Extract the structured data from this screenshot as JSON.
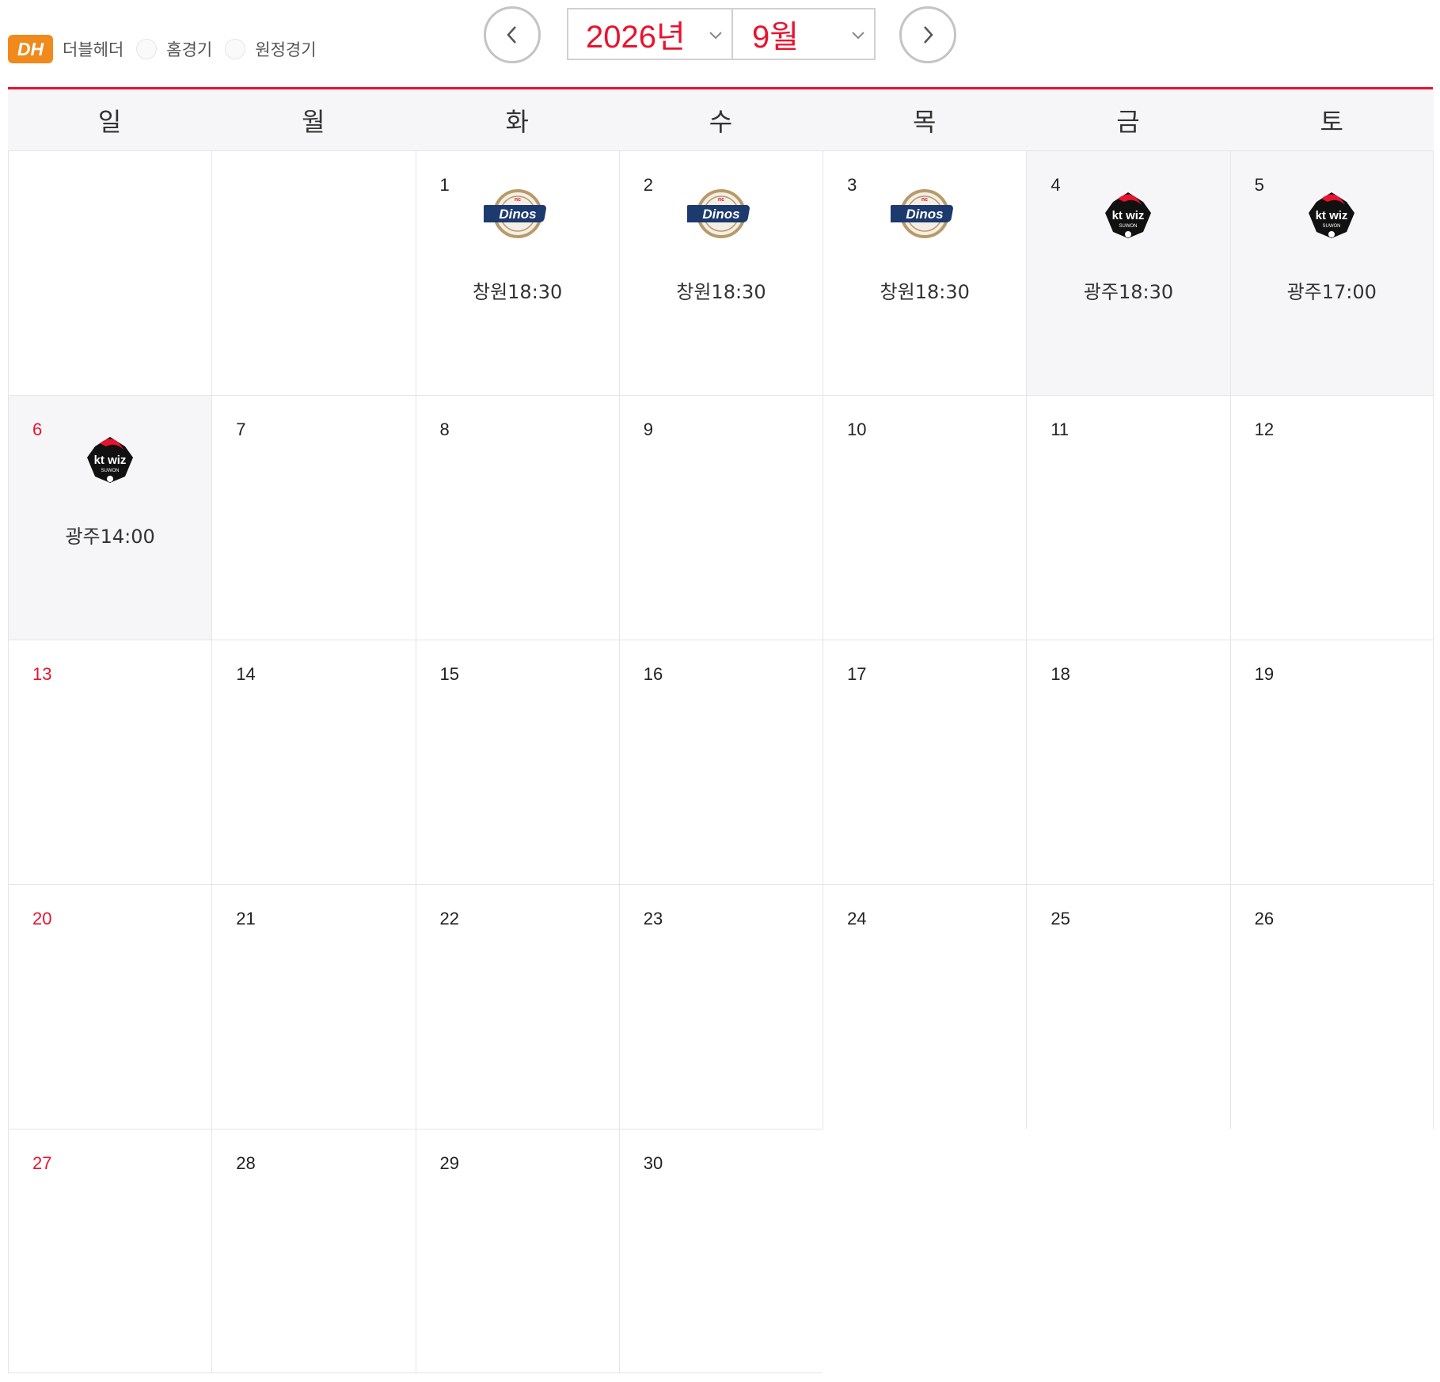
{
  "legend": {
    "dh_badge": "DH",
    "dh_label": "더블헤더",
    "home_label": "홈경기",
    "away_label": "원정경기"
  },
  "selector": {
    "year": "2026년",
    "month": "9월",
    "prev_icon": "chevron-left-icon",
    "next_icon": "chevron-right-icon"
  },
  "colors": {
    "accent_red": "#e8132f",
    "dh_orange": "#f08a1c",
    "header_bg": "#f6f6f8",
    "nc_navy": "#1d3a6e",
    "nc_gold": "#b89a6a",
    "kt_black": "#111111"
  },
  "weekdays": [
    "일",
    "월",
    "화",
    "수",
    "목",
    "금",
    "토"
  ],
  "weeks": [
    [
      {
        "day": ""
      },
      {
        "day": ""
      },
      {
        "day": "1",
        "team": "NC Dinos",
        "logo": "nc-dinos",
        "game": "창원18:30"
      },
      {
        "day": "2",
        "team": "NC Dinos",
        "logo": "nc-dinos",
        "game": "창원18:30"
      },
      {
        "day": "3",
        "team": "NC Dinos",
        "logo": "nc-dinos",
        "game": "창원18:30"
      },
      {
        "day": "4",
        "team": "kt wiz",
        "logo": "kt-wiz",
        "game": "광주18:30",
        "home": true
      },
      {
        "day": "5",
        "team": "kt wiz",
        "logo": "kt-wiz",
        "game": "광주17:00",
        "home": true
      }
    ],
    [
      {
        "day": "6",
        "team": "kt wiz",
        "logo": "kt-wiz",
        "game": "광주14:00",
        "home": true
      },
      {
        "day": "7"
      },
      {
        "day": "8"
      },
      {
        "day": "9"
      },
      {
        "day": "10"
      },
      {
        "day": "11"
      },
      {
        "day": "12"
      }
    ],
    [
      {
        "day": "13"
      },
      {
        "day": "14"
      },
      {
        "day": "15"
      },
      {
        "day": "16"
      },
      {
        "day": "17"
      },
      {
        "day": "18"
      },
      {
        "day": "19"
      }
    ],
    [
      {
        "day": "20"
      },
      {
        "day": "21"
      },
      {
        "day": "22"
      },
      {
        "day": "23"
      },
      {
        "day": "24"
      },
      {
        "day": "25"
      },
      {
        "day": "26"
      }
    ],
    [
      {
        "day": "27"
      },
      {
        "day": "28"
      },
      {
        "day": "29"
      },
      {
        "day": "30"
      },
      {
        "day": ""
      },
      {
        "day": ""
      },
      {
        "day": ""
      }
    ]
  ]
}
